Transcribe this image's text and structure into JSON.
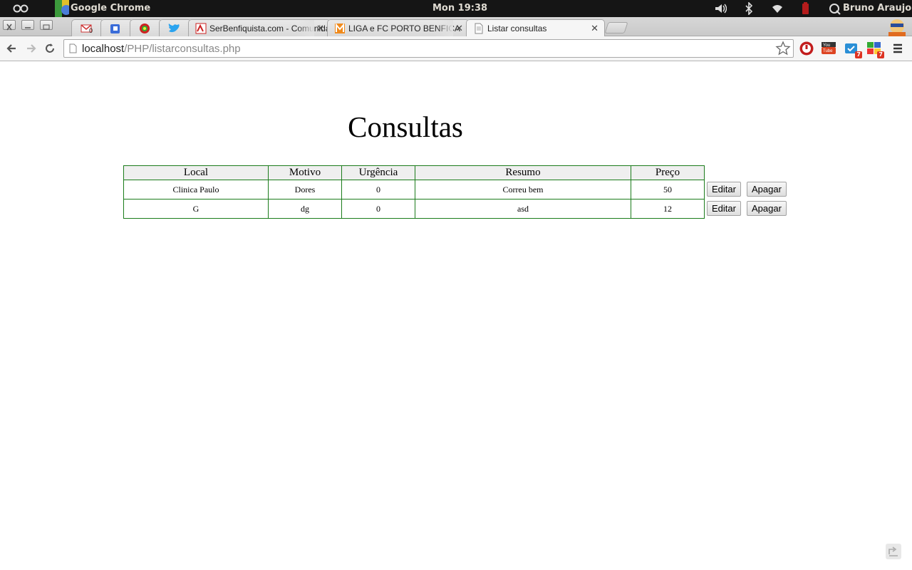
{
  "system_bar": {
    "app_name": "Google Chrome",
    "clock": "Mon 19:38",
    "user": "Bruno Araujo"
  },
  "browser": {
    "tabs": [
      {
        "icon": "gmail-icon",
        "title": "",
        "badge": "0"
      },
      {
        "icon": "google-plus-icon",
        "title": ""
      },
      {
        "icon": "benfica-icon",
        "title": ""
      },
      {
        "icon": "twitter-icon",
        "title": ""
      },
      {
        "icon": "serbenfiquista-icon",
        "title": "SerBenfiquista.com - Comunidade"
      },
      {
        "icon": "maisfutebol-icon",
        "title": "LIGA e FC PORTO BENFICA"
      },
      {
        "icon": "page-icon",
        "title": "Listar consultas",
        "active": true
      }
    ],
    "address": {
      "host": "localhost",
      "path": "/PHP/listarconsultas.php"
    },
    "extension_badges": {
      "ext_3": "7",
      "ext_4": "7"
    }
  },
  "page": {
    "title": "Consultas",
    "table": {
      "headers": [
        "Local",
        "Motivo",
        "Urgência",
        "Resumo",
        "Preço"
      ],
      "rows": [
        [
          "Clinica Paulo",
          "Dores",
          "0",
          "Correu bem",
          "50"
        ],
        [
          "G",
          "dg",
          "0",
          "asd",
          "12"
        ]
      ]
    },
    "actions": {
      "edit_label": "Editar",
      "delete_label": "Apagar"
    }
  }
}
